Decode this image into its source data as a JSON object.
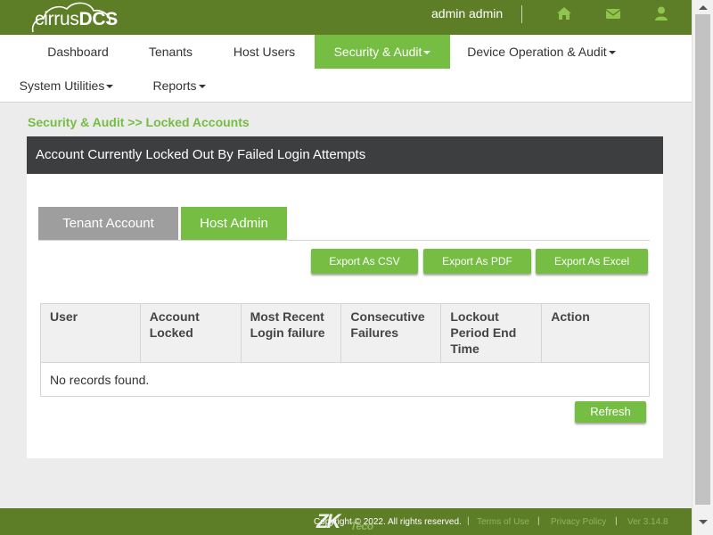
{
  "header": {
    "logo_light": "cirrus",
    "logo_bold": "DCS",
    "user": "admin admin",
    "icons": [
      "home-icon",
      "envelope-icon",
      "user-icon"
    ],
    "bg_color": "#5e7d27"
  },
  "nav": {
    "row1": [
      {
        "label": "Dashboard",
        "dropdown": false,
        "active": false
      },
      {
        "label": "Tenants",
        "dropdown": false,
        "active": false
      },
      {
        "label": "Host Users",
        "dropdown": false,
        "active": false
      },
      {
        "label": "Security & Audit",
        "dropdown": true,
        "active": true
      },
      {
        "label": "Device Operation & Audit",
        "dropdown": true,
        "active": false
      }
    ],
    "row2": [
      {
        "label": "System Utilities",
        "dropdown": true,
        "active": false
      },
      {
        "label": "Reports",
        "dropdown": true,
        "active": false
      }
    ],
    "active_color": "#76bd43"
  },
  "breadcrumb": "Security & Audit >> Locked Accounts",
  "panel": {
    "title": "Account Currently Locked Out By Failed Login Attempts",
    "tabs": [
      {
        "label": "Tenant Account",
        "active": false,
        "color": "#9e9e9e"
      },
      {
        "label": "Host Admin",
        "active": true,
        "color": "#76bd43"
      }
    ],
    "export_buttons": [
      "Export As CSV",
      "Export As PDF",
      "Export As Excel"
    ],
    "table": {
      "columns": [
        "User",
        "Account Locked",
        "Most Recent Login failure",
        "Consecutive Failures",
        "Lockout Period End Time",
        "Action"
      ],
      "empty_message": "No records found."
    },
    "refresh_label": "Refresh"
  },
  "footer": {
    "brand": "ZK",
    "brand_sub": "Teco",
    "copyright": "Copyright © 2022. All rights reserved.",
    "links": [
      "Terms of Use",
      "Privacy Policy"
    ],
    "version": "Ver 3.14.8"
  }
}
